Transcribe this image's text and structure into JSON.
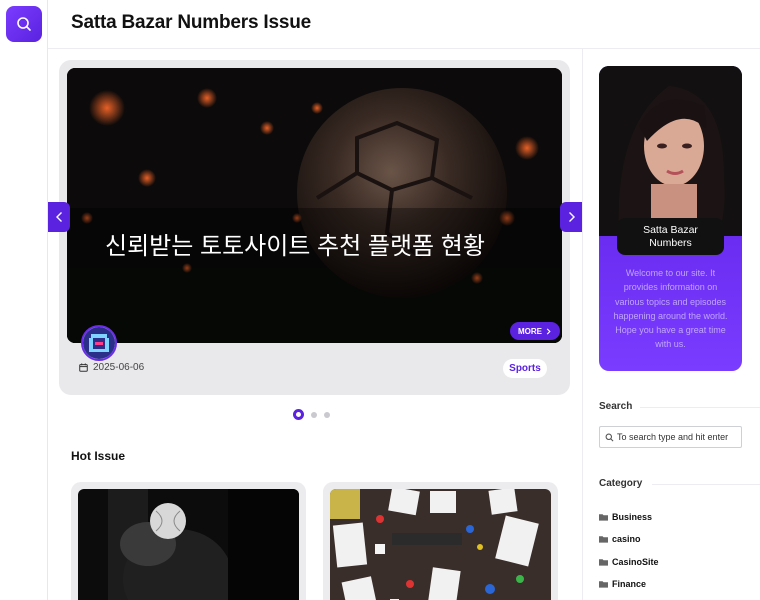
{
  "header": {
    "site_title": "Satta Bazar Numbers Issue"
  },
  "slider": {
    "slide_title": "신뢰받는 토토사이트 추천 플랫폼 현황",
    "more_label": "MORE",
    "date": "2025-06-06",
    "category_tag": "Sports",
    "dots_count": 3,
    "active_dot": 0
  },
  "hot_issue": {
    "title": "Hot Issue"
  },
  "sidebar": {
    "profile": {
      "name": "Satta Bazar Numbers",
      "description": "Welcome to our site. It provides information on various topics and episodes happening around the world. Hope you have a great time with us."
    },
    "search": {
      "heading": "Search",
      "placeholder": "To search type and hit enter"
    },
    "category": {
      "heading": "Category",
      "items": [
        "Business",
        "casino",
        "CasinoSite",
        "Finance"
      ]
    }
  },
  "colors": {
    "accent": "#5b22e0",
    "card_bg": "#e9e9ec"
  }
}
